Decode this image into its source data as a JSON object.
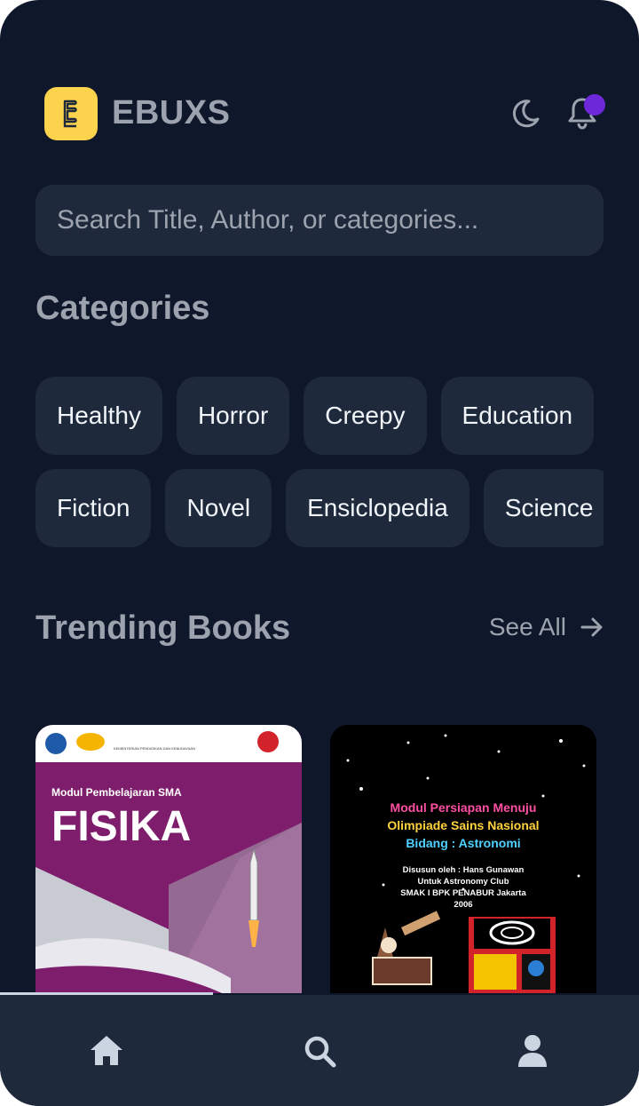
{
  "app": {
    "name": "EBUXS",
    "logo_icon": "book-icon"
  },
  "header": {
    "theme_toggle_icon": "moon-icon",
    "notification_icon": "bell-icon"
  },
  "search": {
    "placeholder": "Search Title, Author, or categories..."
  },
  "categories": {
    "title": "Categories",
    "rows": [
      [
        "Healthy",
        "Horror",
        "Creepy",
        "Education"
      ],
      [
        "Fiction",
        "Novel",
        "Ensiclopedia",
        "Science"
      ]
    ]
  },
  "trending": {
    "title": "Trending Books",
    "see_all_label": "See All",
    "books": [
      {
        "header_text": "KEMENTERIAN PENDIDIKAN DAN KEBUDAYAAN",
        "subtitle": "Modul Pembelajaran SMA",
        "title": "FISIKA"
      },
      {
        "title_lines": [
          "Modul Persiapan Menuju",
          "Olimpiade Sains Nasional",
          "Bidang : Astronomi"
        ],
        "credit_lines": [
          "Disusun oleh : Hans Gunawan",
          "Untuk Astronomy Club",
          "SMAK I BPK PENABUR Jakarta",
          "2006"
        ]
      }
    ]
  },
  "bottom_nav": {
    "items": [
      "home-icon",
      "search-icon",
      "profile-icon"
    ],
    "active": "home-icon"
  },
  "colors": {
    "background": "#0f172a",
    "surface": "#1e293b",
    "accent": "#fcd34d",
    "notification_dot": "#6d28d9",
    "muted_text": "#9ca3af",
    "chip_text": "#f1f5f9"
  }
}
